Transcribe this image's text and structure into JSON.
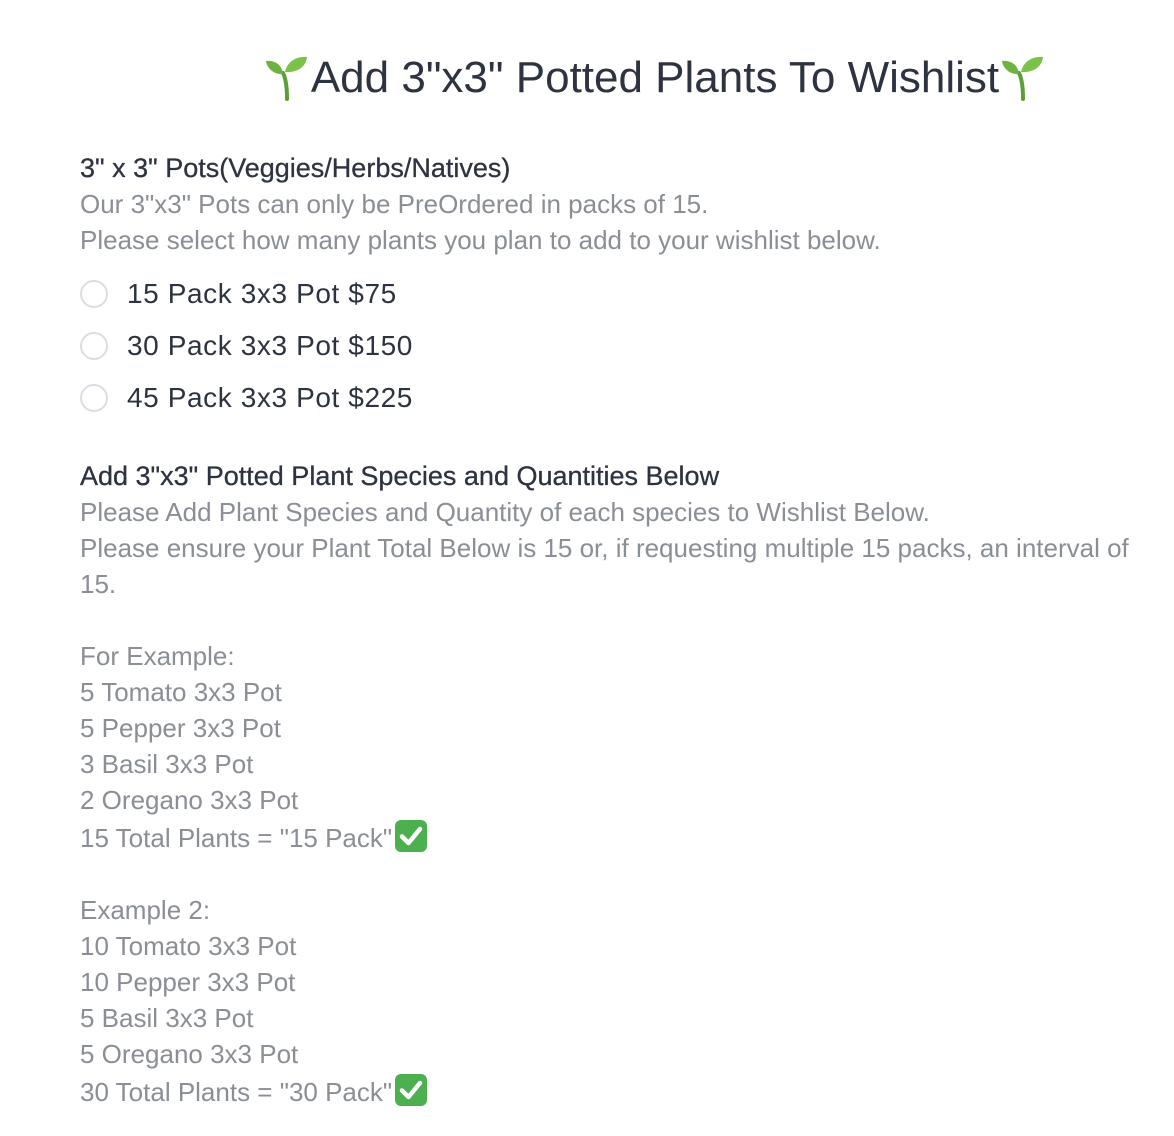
{
  "title": {
    "text": "Add 3\"x3\" Potted Plants To Wishlist",
    "icon": "seedling-emoji"
  },
  "pots_section": {
    "heading": "3\" x 3\" Pots(Veggies/Herbs/Natives)",
    "description_line1": "Our 3\"x3\" Pots can only be PreOrdered in packs of 15.",
    "description_line2": "Please select how many plants you plan to add to your wishlist below.",
    "options": [
      {
        "label": "15 Pack 3x3 Pot $75",
        "selected": false
      },
      {
        "label": "30 Pack 3x3 Pot $150",
        "selected": false
      },
      {
        "label": "45 Pack 3x3 Pot $225",
        "selected": false
      }
    ]
  },
  "species_section": {
    "heading": "Add 3\"x3\" Potted Plant Species and Quantities Below",
    "description_line1": "Please Add Plant Species and Quantity of each species to Wishlist Below.",
    "description_line2": "Please ensure your Plant Total Below is 15 or, if requesting multiple 15 packs, an interval of 15.",
    "example1": {
      "heading": "For Example:",
      "lines": [
        "5 Tomato 3x3 Pot",
        "5 Pepper 3x3 Pot",
        "3 Basil 3x3 Pot",
        "2 Oregano 3x3 Pot"
      ],
      "total": "15 Total Plants = \"15 Pack\"",
      "icon": "check-mark-emoji"
    },
    "example2": {
      "heading": "Example 2:",
      "lines": [
        "10 Tomato 3x3 Pot",
        "10 Pepper 3x3 Pot",
        "5 Basil 3x3 Pot",
        "5 Oregano 3x3 Pot"
      ],
      "total": "30 Total Plants = \"30 Pack\"",
      "icon": "check-mark-emoji"
    }
  },
  "colors": {
    "text": "#2d3340",
    "muted": "#8a8e95",
    "radio_border": "#dadde2",
    "check_green": "#4caf50",
    "sprout_green": "#6cb33f"
  }
}
